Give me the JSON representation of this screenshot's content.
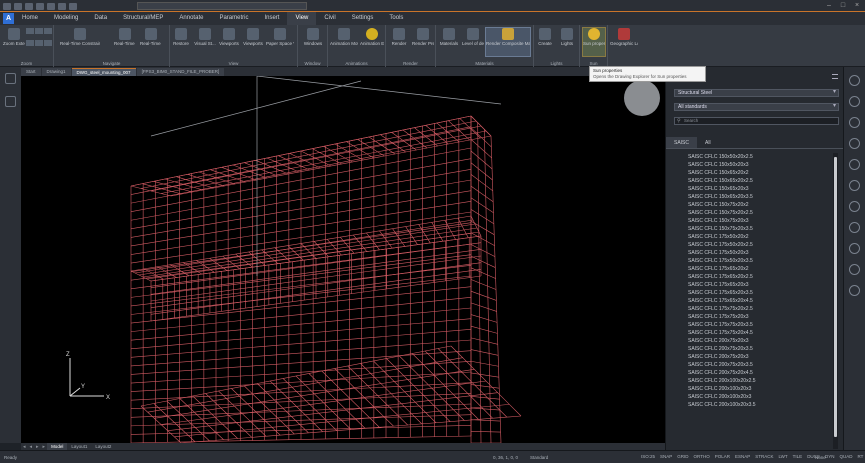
{
  "ribbon_tabs": [
    "Home",
    "Modeling",
    "Data",
    "Structural/MEP",
    "Annotate",
    "Parametric",
    "Insert",
    "View",
    "Civil",
    "Settings",
    "Tools"
  ],
  "active_tab_index": 7,
  "ribbon_groups": {
    "zoom": {
      "title": "Zoom",
      "buttons": [
        "Zoom Extents"
      ]
    },
    "navigate": {
      "title": "Navigate",
      "buttons": [
        "Real-Time Constrained Sphere",
        "Real-Time Pan",
        "Real-Time Scale"
      ]
    },
    "view": {
      "title": "View",
      "buttons": [
        "Restore",
        "Visual St...",
        "Viewports",
        "Viewports",
        "Paper Space Views"
      ]
    },
    "window": {
      "title": "Window",
      "buttons": [
        "Windows"
      ]
    },
    "animations": {
      "title": "Animations",
      "buttons": [
        "Animation Motion Path",
        "Animation Editor"
      ]
    },
    "render": {
      "title": "Render",
      "buttons": [
        "Render",
        "Render Presets"
      ]
    },
    "materials": {
      "title": "Materials",
      "buttons": [
        "Materials",
        "Level of detail",
        "Render Composite Material"
      ]
    },
    "lights": {
      "title": "Lights",
      "buttons": [
        "Create",
        "Lights"
      ]
    },
    "sun": {
      "title": "Sun",
      "buttons": [
        "Sun properties"
      ]
    },
    "geo": {
      "title": "",
      "buttons": [
        "Geographic Location"
      ]
    }
  },
  "tooltip": {
    "title": "Sun properties",
    "desc": "Opens the Drawing Explorer for Sun properties"
  },
  "doc_tabs": [
    "Start",
    "Drawing1",
    "DWG_steel_mounting_007",
    "[FPS3_BIM0_STAND_FILE_PROBER]"
  ],
  "active_doc_tab_index": 2,
  "panel": {
    "select1": "Structural Steel",
    "select2": "All standards",
    "search_placeholder": "Search",
    "tabs": [
      "SAISC",
      "All"
    ],
    "active_tab_index": 0,
    "items": [
      "SAISC CFLC 150x50x20x2.5",
      "SAISC CFLC 150x50x20x3",
      "SAISC CFLC 150x65x20x2",
      "SAISC CFLC 150x65x20x2.5",
      "SAISC CFLC 150x65x20x3",
      "SAISC CFLC 150x65x20x3.5",
      "SAISC CFLC 150x75x20x2",
      "SAISC CFLC 150x75x20x2.5",
      "SAISC CFLC 150x75x20x3",
      "SAISC CFLC 150x75x20x3.5",
      "SAISC CFLC 175x50x20x2",
      "SAISC CFLC 175x50x20x2.5",
      "SAISC CFLC 175x50x20x3",
      "SAISC CFLC 175x50x20x3.5",
      "SAISC CFLC 175x65x20x2",
      "SAISC CFLC 175x65x20x2.5",
      "SAISC CFLC 175x65x20x3",
      "SAISC CFLC 175x65x20x3.5",
      "SAISC CFLC 175x65x20x4.5",
      "SAISC CFLC 175x75x20x2.5",
      "SAISC CFLC 175x75x20x3",
      "SAISC CFLC 175x75x20x3.5",
      "SAISC CFLC 175x75x20x4.5",
      "SAISC CFLC 200x75x20x3",
      "SAISC CFLC 200x75x20x3.5",
      "SAISC CFLC 200x75x20x3",
      "SAISC CFLC 200x75x20x3.5",
      "SAISC CFLC 200x75x20x4.5",
      "SAISC CFLC 200x100x20x2.5",
      "SAISC CFLC 200x100x20x3",
      "SAISC CFLC 200x100x20x3",
      "SAISC CFLC 200x100x20x3.5"
    ]
  },
  "layout_tabs": [
    "Model",
    "Layout1",
    "Layout2"
  ],
  "active_layout_tab_index": 0,
  "status": {
    "ready": "Ready",
    "coords": "0, 36, 1, 0, 0",
    "standard": "Standard",
    "buttons": [
      "ISO:25",
      "SNAP",
      "GRID",
      "ORTHO",
      "POLAR",
      "ESNAP",
      "STRACK",
      "LWT",
      "TILE",
      "DUCS",
      "DYN",
      "QUAD",
      "RT",
      "HKA",
      "LOCK"
    ],
    "scale": "None"
  },
  "colors": {
    "accent": "#c9742a",
    "wire": "#d05a62",
    "viewport_bg": "#000000",
    "app_blue": "#2f6fd6"
  },
  "axes": {
    "x": "X",
    "y": "Y",
    "z": "Z"
  }
}
